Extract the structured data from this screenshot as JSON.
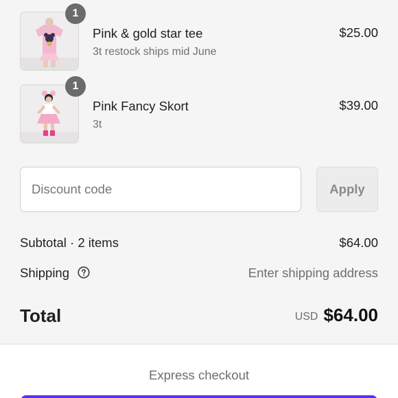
{
  "line_items": [
    {
      "quantity": "1",
      "title": "Pink & gold star tee",
      "variant": "3t restock ships mid June",
      "price": "$25.00",
      "image": "pink-tee-photo"
    },
    {
      "quantity": "1",
      "title": "Pink Fancy Skort",
      "variant": "3t",
      "price": "$39.00",
      "image": "pink-skort-photo"
    }
  ],
  "discount": {
    "placeholder": "Discount code",
    "apply_label": "Apply"
  },
  "subtotal": {
    "label": "Subtotal · 2 items",
    "value": "$64.00"
  },
  "shipping": {
    "label": "Shipping",
    "value": "Enter shipping address",
    "icon": "help-circle-icon"
  },
  "total": {
    "label": "Total",
    "currency": "USD",
    "amount": "$64.00"
  },
  "express": {
    "label": "Express checkout",
    "button_color": "#5a31f4"
  }
}
